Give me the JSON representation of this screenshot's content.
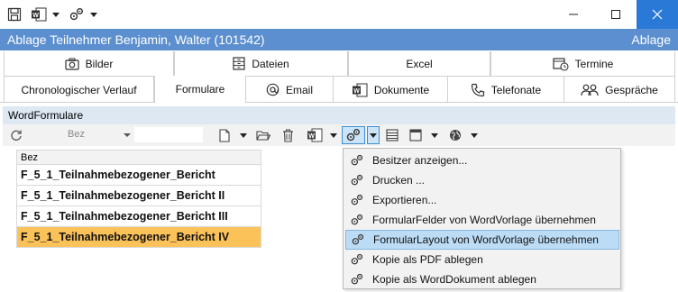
{
  "quick_access": {
    "icons": [
      "save-icon",
      "word-document-icon",
      "gears-icon"
    ]
  },
  "window": {
    "title": "Ablage Teilnehmer Benjamin, Walter (101542)",
    "area": "Ablage"
  },
  "tabs_row1": [
    {
      "label": "Bilder",
      "icon": "camera-icon"
    },
    {
      "label": "Dateien",
      "icon": "cabinet-icon"
    },
    {
      "label": "Excel",
      "icon": ""
    },
    {
      "label": "Termine",
      "icon": "calendar-clock-icon"
    }
  ],
  "tabs_row2": [
    {
      "label": "Chronologischer Verlauf",
      "icon": ""
    },
    {
      "label": "Formulare",
      "icon": "",
      "active": true
    },
    {
      "label": "Email",
      "icon": "at-icon"
    },
    {
      "label": "Dokumente",
      "icon": "word-icon"
    },
    {
      "label": "Telefonate",
      "icon": "phone-icon"
    },
    {
      "label": "Gespräche",
      "icon": "people-icon"
    }
  ],
  "section": {
    "label": "WordFormulare"
  },
  "toolbar": {
    "filter_field": "Bez",
    "filter_value": ""
  },
  "grid": {
    "column": "Bez",
    "rows": [
      {
        "label": "F_5_1_Teilnahmebezogener_Bericht",
        "selected": false
      },
      {
        "label": "F_5_1_Teilnahmebezogener_Bericht II",
        "selected": false
      },
      {
        "label": "F_5_1_Teilnahmebezogener_Bericht III",
        "selected": false
      },
      {
        "label": "F_5_1_Teilnahmebezogener_Bericht IV",
        "selected": true
      }
    ]
  },
  "menu": {
    "items": [
      {
        "label": "Besitzer anzeigen...",
        "icon": "gears-icon"
      },
      {
        "label": "Drucken ...",
        "icon": "gears-icon"
      },
      {
        "label": "Exportieren...",
        "icon": "gears-icon"
      },
      {
        "label": "FormularFelder von WordVorlage übernehmen",
        "icon": "gears-icon"
      },
      {
        "label": "FormularLayout von WordVorlage übernehmen",
        "icon": "gears-icon",
        "highlighted": true
      },
      {
        "label": "Kopie als PDF ablegen",
        "icon": "gears-icon"
      },
      {
        "label": "Kopie als WordDokument ablegen",
        "icon": "gears-icon"
      }
    ]
  },
  "colors": {
    "header_bg": "#5c8fcf",
    "close_button_bg": "#2b79d7",
    "selected_row": "#fcc25a",
    "menu_highlight": "#bcdcf5"
  }
}
